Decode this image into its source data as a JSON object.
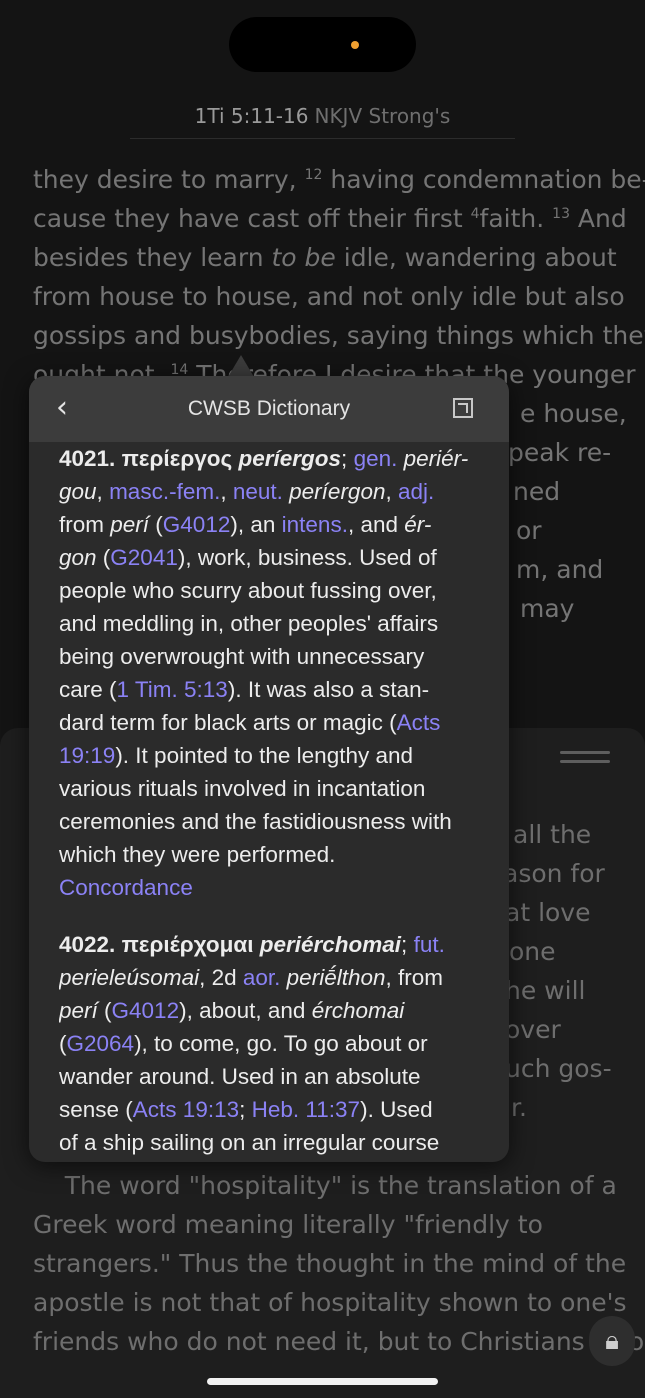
{
  "header": {
    "reference": "1Ti 5:11-16",
    "version": "NKJV Strong's"
  },
  "bible_text": {
    "line1": "they desire to marry,",
    "v12": "12",
    "line1b": " having condemnation be-",
    "line2": "cause they have cast off their first ",
    "fn4": "4",
    "line2b": "faith. ",
    "v13": "13",
    "line2c": " And",
    "line3a": "besides they learn ",
    "line3i": "to be",
    "line3b": " idle, wandering about",
    "line4": "from house to house, and not only idle but also",
    "line5": "gossips and busybodies, saying things which they",
    "line6": "ought not. ",
    "v14": "14",
    "line6b": " Therefore I desire that the younger",
    "r7": "e house,",
    "r8": "peak re-",
    "r9": "ned",
    "r10": "or",
    "r11": "m, and",
    "r12": "may"
  },
  "commentary": {
    "r1": "all the",
    "r2": "ason for",
    "r3": "at love",
    "r4": "one",
    "r5": "he will",
    "r6": "over",
    "r7": "uch gos-",
    "r8": "r.",
    "p1": "    The word \"hospitality\" is the translation of a",
    "p2": "Greek word meaning literally \"friendly to",
    "p3": "strangers.\" Thus the thought in the mind of the",
    "p4": "apostle is not that of hospitality shown to one's",
    "p5": "friends who do not need it, but to Christians who"
  },
  "popup": {
    "title": "CWSB Dictionary",
    "back_icon": "chevron-left-icon",
    "open_icon": "open-external-icon",
    "entry1": {
      "num": "4021.",
      "greek": "περίεργος",
      "translit": "períergos",
      "semi": ";",
      "gen": "gen.",
      "gen_form_a": "periér-",
      "gen_form_b": "gou",
      "masc": "masc.-fem.",
      "neut": "neut.",
      "neut_form": "períergon",
      "adj": "adj.",
      "from": "from",
      "peri": "perí",
      "g4012": "G4012",
      "an": "), an",
      "intens": "intens.",
      "and": ", and",
      "ergon_a": "ér-",
      "ergon_b": "gon",
      "g2041": "G2041",
      "def1": "), work, business. Used of",
      "def2": "people who scurry about fussing over,",
      "def3": "and meddling in, other peoples' affairs",
      "def4": "being overwrought with unnecessary",
      "care": "care (",
      "tim": "1 Tim. 5:13",
      "def5": "). It was also a stan-",
      "def6": "dard term for black arts or magic (",
      "acts_a": "Acts",
      "acts_b": "19:19",
      "def7": "). It pointed to the lengthy and",
      "def8": "various rituals involved in incantation",
      "def9": "ceremonies and the fastidiousness with",
      "def10": "which they were performed.",
      "concordance": "Concordance"
    },
    "entry2": {
      "num": "4022.",
      "greek": "περιέρχομαι",
      "translit": "periérchomai",
      "semi": ";",
      "fut": "fut.",
      "fut_form": "perieleúsomai",
      "second": ", 2d",
      "aor": "aor.",
      "aor_form": "periḗlthon",
      "from": ", from",
      "peri": "perí",
      "g4012": "G4012",
      "about": "), about, and",
      "erchomai": "érchomai",
      "g2064": "G2064",
      "def1": "), to come, go. To go about or",
      "def2": "wander around. Used in an absolute",
      "sense": "sense (",
      "acts": "Acts 19:13",
      "semi2": ";",
      "heb": "Heb. 11:37",
      "def3": "). Used",
      "def4": "of a ship sailing on an irregular course"
    }
  },
  "lock_icon": "lock-icon"
}
